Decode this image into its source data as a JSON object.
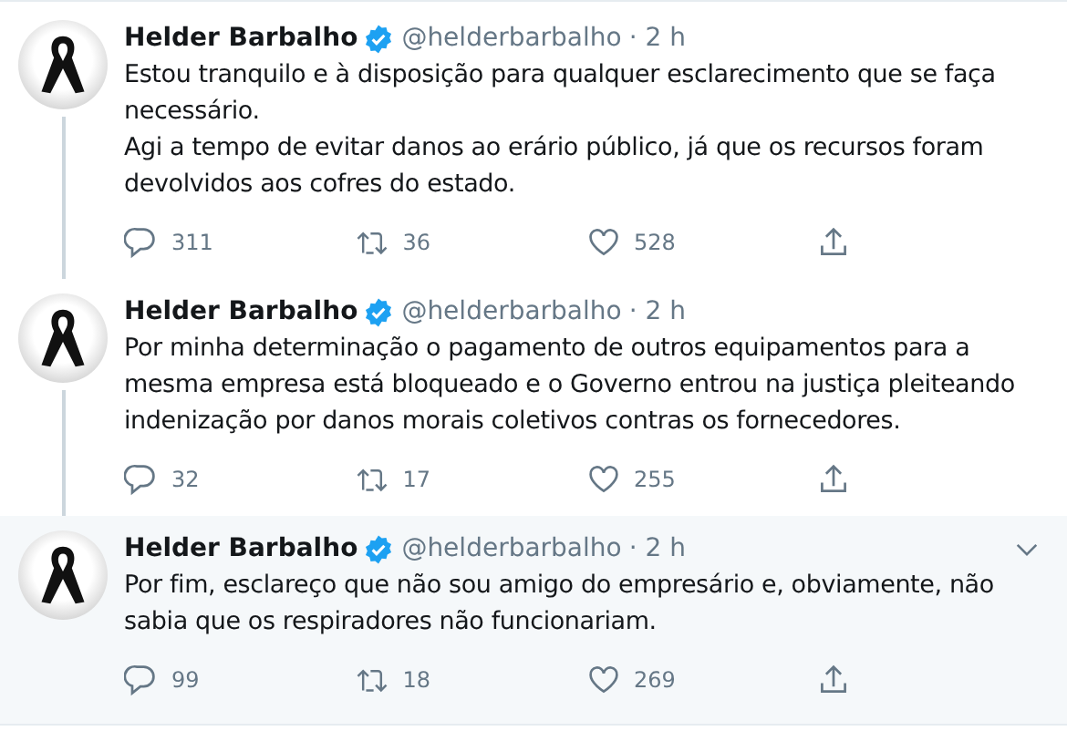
{
  "tweets": [
    {
      "name": "Helder Barbalho",
      "verified": true,
      "handle": "@helderbarbalho",
      "time": "· 2 h",
      "highlighted": false,
      "thread_continues": true,
      "paragraphs": [
        "Estou tranquilo e à disposição para qualquer esclarecimento que se faça necessário.",
        "Agi a tempo de evitar danos ao erário público, já que os recursos foram devolvidos aos cofres do estado."
      ],
      "replies": "311",
      "retweets": "36",
      "likes": "528"
    },
    {
      "name": "Helder Barbalho",
      "verified": true,
      "handle": "@helderbarbalho",
      "time": "· 2 h",
      "highlighted": false,
      "thread_continues": true,
      "paragraphs": [
        "Por minha determinação o pagamento de outros equipamentos para a mesma empresa está bloqueado e o Governo entrou na justiça pleiteando indenização por danos morais coletivos contras os fornecedores."
      ],
      "replies": "32",
      "retweets": "17",
      "likes": "255"
    },
    {
      "name": "Helder Barbalho",
      "verified": true,
      "handle": "@helderbarbalho",
      "time": "· 2 h",
      "highlighted": true,
      "thread_continues": false,
      "paragraphs": [
        "Por fim, esclareço que não sou amigo do empresário e, obviamente, não sabia que os respiradores não funcionariam."
      ],
      "replies": "99",
      "retweets": "18",
      "likes": "269"
    }
  ]
}
